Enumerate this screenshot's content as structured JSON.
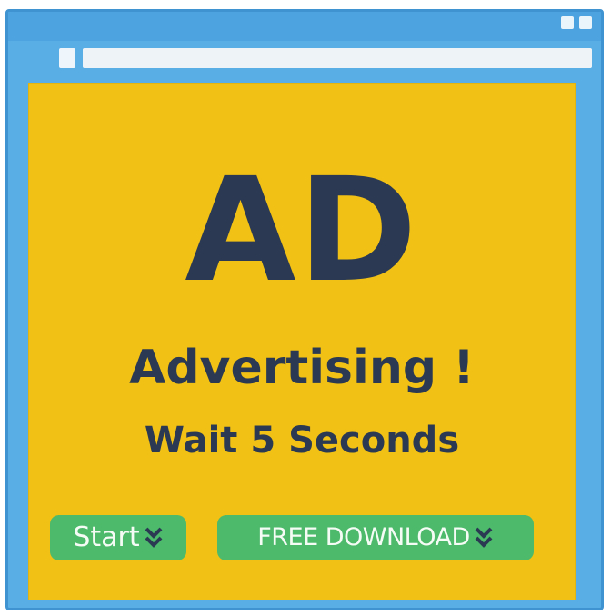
{
  "window": {
    "accent": "#4da3df"
  },
  "ad": {
    "headline": "AD",
    "subtitle": "Advertising !",
    "wait_text": "Wait 5 Seconds",
    "background": "#f2c115",
    "text_color": "#2b3a52"
  },
  "buttons": {
    "start_label": "Start",
    "download_label": "FREE DOWNLOAD",
    "color": "#4cb96b",
    "icon": "double-chevron-down-icon"
  }
}
